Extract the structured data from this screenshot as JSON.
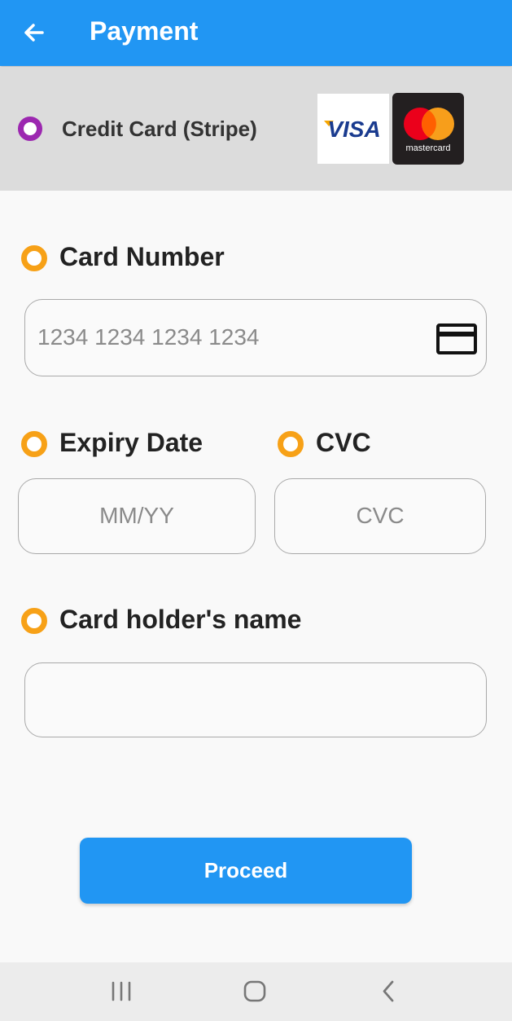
{
  "appbar": {
    "title": "Payment",
    "back_icon": "arrow-left-icon"
  },
  "payment_method": {
    "label": "Credit Card (Stripe)",
    "selected": true,
    "logos": [
      {
        "name": "visa-logo",
        "text": "VISA"
      },
      {
        "name": "mastercard-logo",
        "text": "mastercard"
      }
    ]
  },
  "form": {
    "card_number": {
      "label": "Card Number",
      "placeholder": "1234 1234 1234 1234",
      "icon": "credit-card-icon"
    },
    "expiry": {
      "label": "Expiry Date",
      "placeholder": "MM/YY"
    },
    "cvc": {
      "label": "CVC",
      "placeholder": "CVC"
    },
    "holder": {
      "label": "Card holder's name",
      "placeholder": ""
    }
  },
  "actions": {
    "proceed_label": "Proceed"
  },
  "system_nav": {
    "items": [
      "recents-icon",
      "home-icon",
      "back-icon"
    ]
  },
  "colors": {
    "primary": "#2196f3",
    "radio_selected": "#9c27b0",
    "radio_bullet": "#f7a117",
    "method_bg": "#dcdcdc"
  }
}
